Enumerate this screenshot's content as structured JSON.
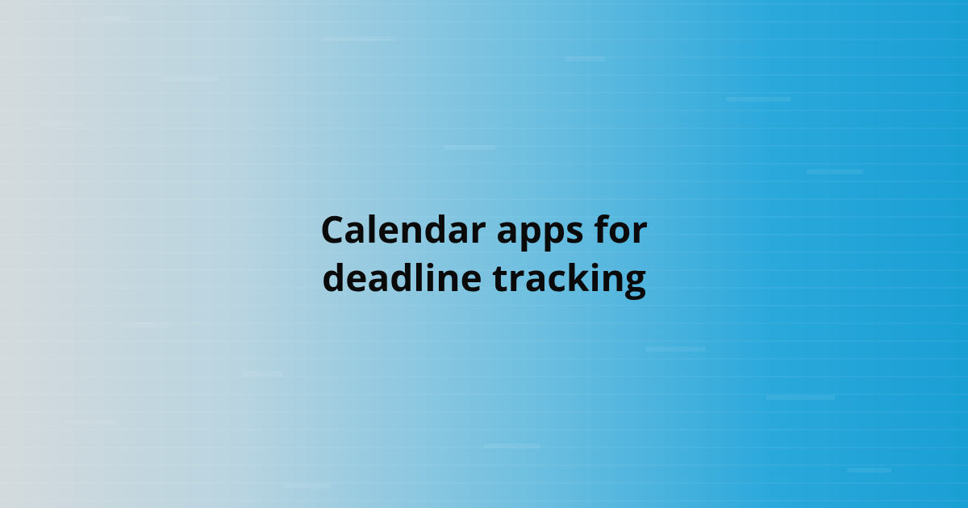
{
  "title": "Calendar apps for deadline tracking"
}
